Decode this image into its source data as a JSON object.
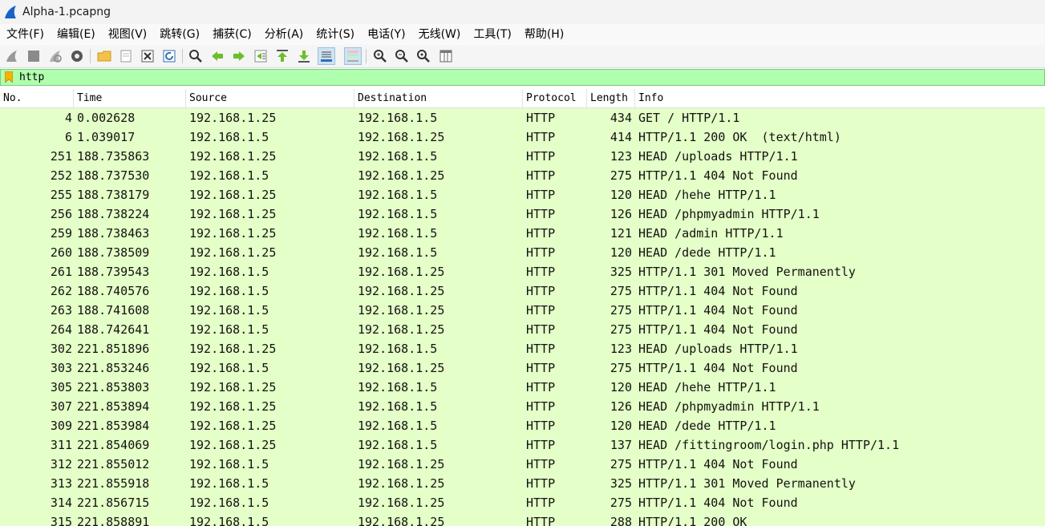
{
  "window": {
    "title": "Alpha-1.pcapng"
  },
  "menu": [
    "文件(F)",
    "编辑(E)",
    "视图(V)",
    "跳转(G)",
    "捕获(C)",
    "分析(A)",
    "统计(S)",
    "电话(Y)",
    "无线(W)",
    "工具(T)",
    "帮助(H)"
  ],
  "toolbar": {
    "icons": [
      "start-capture-icon",
      "stop-capture-icon",
      "restart-capture-icon",
      "capture-options-icon",
      "open-file-icon",
      "save-file-icon",
      "close-file-icon",
      "reload-icon",
      "find-packet-icon",
      "go-back-icon",
      "go-forward-icon",
      "go-to-packet-icon",
      "go-first-icon",
      "go-last-icon",
      "autoscroll-icon",
      "colorize-icon",
      "zoom-in-icon",
      "zoom-out-icon",
      "zoom-normal-icon",
      "resize-columns-icon"
    ]
  },
  "filter": {
    "value": "http",
    "color": "#afffaf"
  },
  "columns": [
    "No.",
    "Time",
    "Source",
    "Destination",
    "Protocol",
    "Length",
    "Info"
  ],
  "row_color": "#e4ffc7",
  "packets": [
    {
      "no": "4",
      "time": "0.002628",
      "src": "192.168.1.25",
      "dst": "192.168.1.5",
      "proto": "HTTP",
      "len": "434",
      "info": "GET / HTTP/1.1"
    },
    {
      "no": "6",
      "time": "1.039017",
      "src": "192.168.1.5",
      "dst": "192.168.1.25",
      "proto": "HTTP",
      "len": "414",
      "info": "HTTP/1.1 200 OK  (text/html)"
    },
    {
      "no": "251",
      "time": "188.735863",
      "src": "192.168.1.25",
      "dst": "192.168.1.5",
      "proto": "HTTP",
      "len": "123",
      "info": "HEAD /uploads HTTP/1.1"
    },
    {
      "no": "252",
      "time": "188.737530",
      "src": "192.168.1.5",
      "dst": "192.168.1.25",
      "proto": "HTTP",
      "len": "275",
      "info": "HTTP/1.1 404 Not Found"
    },
    {
      "no": "255",
      "time": "188.738179",
      "src": "192.168.1.25",
      "dst": "192.168.1.5",
      "proto": "HTTP",
      "len": "120",
      "info": "HEAD /hehe HTTP/1.1"
    },
    {
      "no": "256",
      "time": "188.738224",
      "src": "192.168.1.25",
      "dst": "192.168.1.5",
      "proto": "HTTP",
      "len": "126",
      "info": "HEAD /phpmyadmin HTTP/1.1"
    },
    {
      "no": "259",
      "time": "188.738463",
      "src": "192.168.1.25",
      "dst": "192.168.1.5",
      "proto": "HTTP",
      "len": "121",
      "info": "HEAD /admin HTTP/1.1"
    },
    {
      "no": "260",
      "time": "188.738509",
      "src": "192.168.1.25",
      "dst": "192.168.1.5",
      "proto": "HTTP",
      "len": "120",
      "info": "HEAD /dede HTTP/1.1"
    },
    {
      "no": "261",
      "time": "188.739543",
      "src": "192.168.1.5",
      "dst": "192.168.1.25",
      "proto": "HTTP",
      "len": "325",
      "info": "HTTP/1.1 301 Moved Permanently"
    },
    {
      "no": "262",
      "time": "188.740576",
      "src": "192.168.1.5",
      "dst": "192.168.1.25",
      "proto": "HTTP",
      "len": "275",
      "info": "HTTP/1.1 404 Not Found"
    },
    {
      "no": "263",
      "time": "188.741608",
      "src": "192.168.1.5",
      "dst": "192.168.1.25",
      "proto": "HTTP",
      "len": "275",
      "info": "HTTP/1.1 404 Not Found"
    },
    {
      "no": "264",
      "time": "188.742641",
      "src": "192.168.1.5",
      "dst": "192.168.1.25",
      "proto": "HTTP",
      "len": "275",
      "info": "HTTP/1.1 404 Not Found"
    },
    {
      "no": "302",
      "time": "221.851896",
      "src": "192.168.1.25",
      "dst": "192.168.1.5",
      "proto": "HTTP",
      "len": "123",
      "info": "HEAD /uploads HTTP/1.1"
    },
    {
      "no": "303",
      "time": "221.853246",
      "src": "192.168.1.5",
      "dst": "192.168.1.25",
      "proto": "HTTP",
      "len": "275",
      "info": "HTTP/1.1 404 Not Found"
    },
    {
      "no": "305",
      "time": "221.853803",
      "src": "192.168.1.25",
      "dst": "192.168.1.5",
      "proto": "HTTP",
      "len": "120",
      "info": "HEAD /hehe HTTP/1.1"
    },
    {
      "no": "307",
      "time": "221.853894",
      "src": "192.168.1.25",
      "dst": "192.168.1.5",
      "proto": "HTTP",
      "len": "126",
      "info": "HEAD /phpmyadmin HTTP/1.1"
    },
    {
      "no": "309",
      "time": "221.853984",
      "src": "192.168.1.25",
      "dst": "192.168.1.5",
      "proto": "HTTP",
      "len": "120",
      "info": "HEAD /dede HTTP/1.1"
    },
    {
      "no": "311",
      "time": "221.854069",
      "src": "192.168.1.25",
      "dst": "192.168.1.5",
      "proto": "HTTP",
      "len": "137",
      "info": "HEAD /fittingroom/login.php HTTP/1.1"
    },
    {
      "no": "312",
      "time": "221.855012",
      "src": "192.168.1.5",
      "dst": "192.168.1.25",
      "proto": "HTTP",
      "len": "275",
      "info": "HTTP/1.1 404 Not Found"
    },
    {
      "no": "313",
      "time": "221.855918",
      "src": "192.168.1.5",
      "dst": "192.168.1.25",
      "proto": "HTTP",
      "len": "325",
      "info": "HTTP/1.1 301 Moved Permanently"
    },
    {
      "no": "314",
      "time": "221.856715",
      "src": "192.168.1.5",
      "dst": "192.168.1.25",
      "proto": "HTTP",
      "len": "275",
      "info": "HTTP/1.1 404 Not Found"
    },
    {
      "no": "315",
      "time": "221.858891",
      "src": "192.168.1.5",
      "dst": "192.168.1.25",
      "proto": "HTTP",
      "len": "288",
      "info": "HTTP/1.1 200 OK"
    }
  ]
}
